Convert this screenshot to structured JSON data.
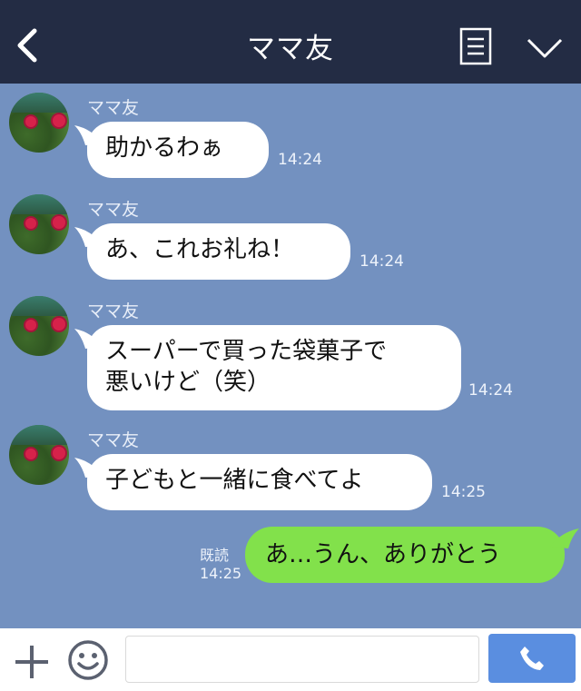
{
  "header": {
    "title": "ママ友"
  },
  "messages": [
    {
      "sender": "ママ友",
      "text": "助かるわぁ",
      "time": "14:24"
    },
    {
      "sender": "ママ友",
      "text": "あ、これお礼ね！",
      "time": "14:24"
    },
    {
      "sender": "ママ友",
      "line1": "スーパーで買った袋菓子で",
      "line2": "悪いけど（笑）",
      "time": "14:24"
    },
    {
      "sender": "ママ友",
      "text": "子どもと一緒に食べてよ",
      "time": "14:25"
    }
  ],
  "my_message": {
    "text": "あ…うん、ありがとう",
    "read_label": "既読",
    "time": "14:25"
  },
  "footer": {
    "input_value": ""
  },
  "colors": {
    "header_bg": "#232c44",
    "chat_bg": "#7391c0",
    "my_bubble": "#82e14b",
    "call_button": "#5a8ee0"
  },
  "icons": [
    "back-icon",
    "menu-icon",
    "chevron-down-icon",
    "plus-icon",
    "emoji-icon",
    "phone-icon"
  ]
}
